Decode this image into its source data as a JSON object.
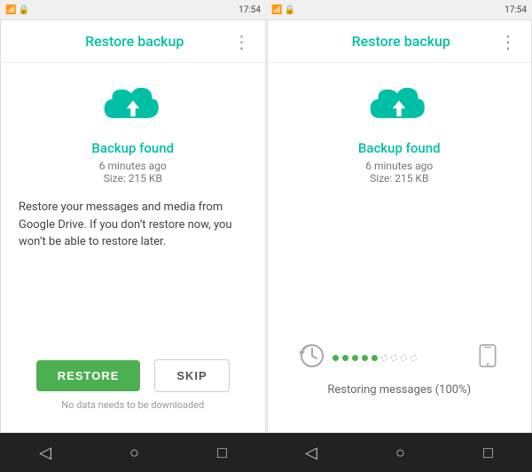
{
  "left_panel": {
    "title": "Restore backup",
    "backup_status": "Backup found",
    "backup_time": "6 minutes ago",
    "backup_size": "Size: 215 KB",
    "restore_description": "Restore your messages and media from Google Drive. If you don’t restore now, you won’t be able to restore later.",
    "restore_button": "RESTORE",
    "skip_button": "SKIP",
    "no_data_text": "No data needs to be downloaded"
  },
  "right_panel": {
    "title": "Restore backup",
    "backup_status": "Backup found",
    "backup_time": "6 minutes ago",
    "backup_size": "Size: 215 KB",
    "restoring_text": "Restoring messages (100%)"
  },
  "status_bar": {
    "left_time": "17:54",
    "right_time": "17:54"
  },
  "nav": {
    "back": "◁",
    "home": "○",
    "recents": "□"
  },
  "colors": {
    "teal": "#00BFA5",
    "green": "#4CAF50",
    "dot_green": "#4CAF50",
    "dot_empty": "#ccc"
  }
}
